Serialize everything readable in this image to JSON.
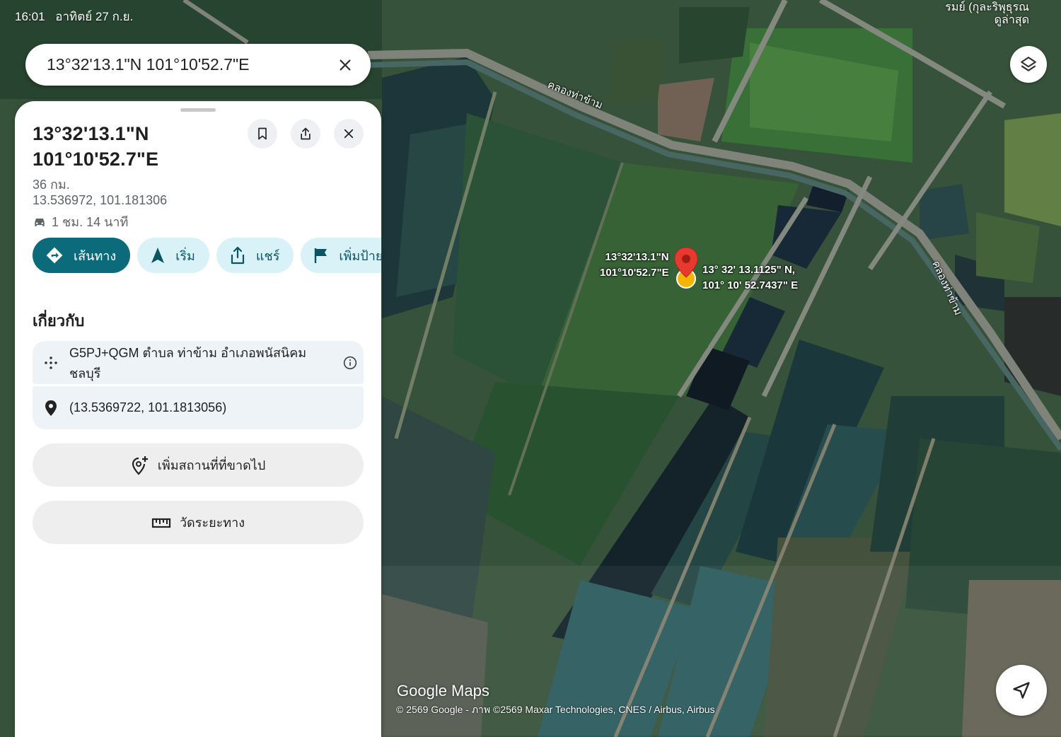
{
  "status_bar": {
    "time": "16:01",
    "date": "อาทิตย์ 27 ก.ย."
  },
  "search": {
    "query": "13°32'13.1\"N 101°10'52.7\"E",
    "clear_icon": "close-icon"
  },
  "panel": {
    "title": "13°32'13.1\"N 101°10'52.7\"E",
    "distance": "36 กม.",
    "decimal_coords": "13.536972, 101.181306",
    "drive_time": "1 ชม. 14 นาที",
    "actions": [
      {
        "label": "เส้นทาง",
        "icon": "directions-icon"
      },
      {
        "label": "เริ่ม",
        "icon": "navigation-arrow-icon"
      },
      {
        "label": "แชร์",
        "icon": "share-icon"
      },
      {
        "label": "เพิ่มป้ายกำกับ",
        "icon": "flag-icon"
      }
    ],
    "about_heading": "เกี่ยวกับ",
    "plus_code": "G5PJ+QGM ตำบล ท่าข้าม อำเภอพนัสนิคม ชลบุรี",
    "coords_paren": "(13.5369722, 101.1813056)",
    "add_place": "เพิ่มสถานที่ที่ขาดไป",
    "measure": "วัดระยะทาง"
  },
  "map": {
    "pin_label_line1": "13°32'13.1\"N",
    "pin_label_line2": "101°10'52.7\"E",
    "dms_line1": "13° 32' 13.1125\" N,",
    "dms_line2": "101° 10' 52.7437\" E",
    "canal_label": "คลองท่าข้าม",
    "top_right_label": "รมย์ (กุละริพุธุรณ",
    "top_right_sub": "ดูล่าสุด",
    "watermark": "Google Maps",
    "copyright": "© 2569 Google - ภาพ ©2569 Maxar Technologies, CNES / Airbus, Airbus"
  },
  "colors": {
    "accent": "#0b6b7a",
    "chip_bg": "#d9f2f7",
    "pin": "#e8392f",
    "pin_dot": "#f4b400"
  }
}
